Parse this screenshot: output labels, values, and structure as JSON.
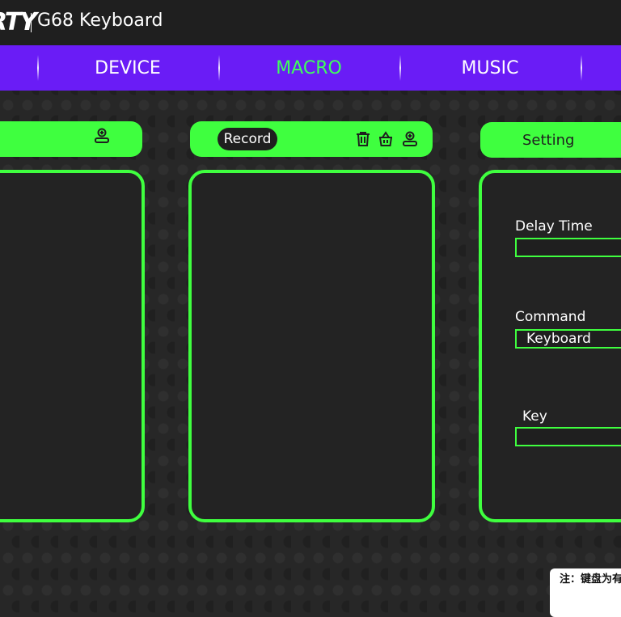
{
  "header": {
    "brand": "RTY",
    "title": "G68 Keyboard"
  },
  "nav": {
    "tabs": [
      {
        "label": "DEVICE",
        "active": false
      },
      {
        "label": "MACRO",
        "active": true
      },
      {
        "label": "MUSIC",
        "active": false
      }
    ]
  },
  "macro_list": {
    "icons": [
      "add-icon"
    ]
  },
  "record_panel": {
    "record_label": "Record",
    "icons": [
      "trash-icon",
      "basket-icon",
      "add-icon"
    ]
  },
  "setting_panel": {
    "title": "Setting",
    "delay_label": "Delay Time",
    "delay_value": "",
    "command_label": "Command",
    "command_value": "Keyboard",
    "key_label": "Key",
    "key_value": ""
  },
  "note": {
    "text": "注：键盘为有"
  },
  "colors": {
    "accent_green": "#3fff3f",
    "nav_purple": "#6a1cf6",
    "active_tab": "#3fff5c",
    "background": "#272727"
  }
}
